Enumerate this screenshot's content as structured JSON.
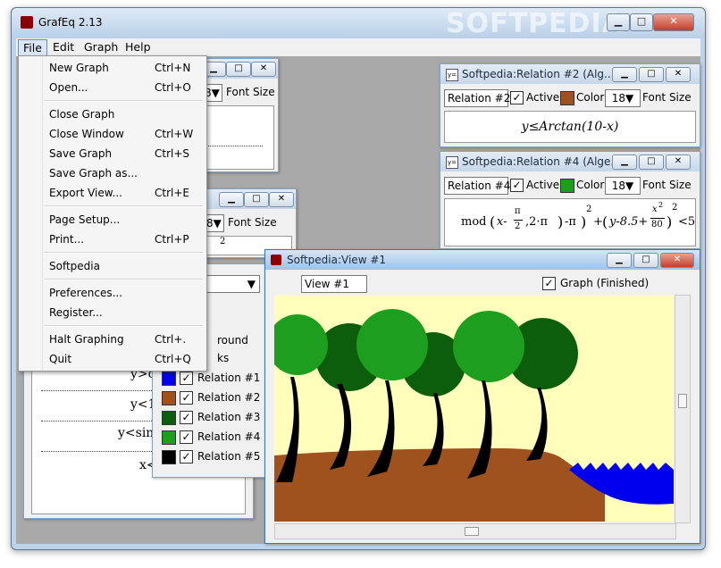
{
  "app": {
    "title": "GrafEq 2.13",
    "watermark": "SOFTPEDIA"
  },
  "menubar": [
    "File",
    "Edit",
    "Graph",
    "Help"
  ],
  "file_menu": {
    "groups": [
      [
        {
          "label": "New Graph",
          "shortcut": "Ctrl+N"
        },
        {
          "label": "Open...",
          "shortcut": "Ctrl+O"
        }
      ],
      [
        {
          "label": "Close Graph",
          "shortcut": ""
        },
        {
          "label": "Close Window",
          "shortcut": "Ctrl+W"
        },
        {
          "label": "Save Graph",
          "shortcut": "Ctrl+S"
        },
        {
          "label": "Save Graph as...",
          "shortcut": ""
        },
        {
          "label": "Export View...",
          "shortcut": "Ctrl+E"
        }
      ],
      [
        {
          "label": "Page Setup...",
          "shortcut": ""
        },
        {
          "label": "Print...",
          "shortcut": "Ctrl+P"
        }
      ],
      [
        {
          "label": "Softpedia",
          "shortcut": ""
        }
      ],
      [
        {
          "label": "Preferences...",
          "shortcut": ""
        },
        {
          "label": "Register...",
          "shortcut": ""
        }
      ],
      [
        {
          "label": "Halt Graphing",
          "shortcut": "Ctrl+."
        },
        {
          "label": "Quit",
          "shortcut": "Ctrl+Q"
        }
      ]
    ]
  },
  "rel2": {
    "title": "Softpedia:Relation #2 (Alg...",
    "name": "Relation #2",
    "active": "Active",
    "color_label": "Color",
    "color": "#a0521e",
    "font_size": "18",
    "font_size_label": "Font Size",
    "formula": "y≤Arctan(10-x)"
  },
  "rel4": {
    "title": "Softpedia:Relation #4 (Alge...",
    "name": "Relation #4",
    "active": "Active",
    "color_label": "Color",
    "color": "#1e9e1e",
    "font_size": "18",
    "font_size_label": "Font Size",
    "formula": {
      "f1": "mod",
      "f2": "x-",
      "f3": "π",
      "f4": "2",
      "f5": ",2·π",
      "f6": "-π",
      "f7": "2",
      "f8": "+",
      "f9": "y-8.5+",
      "f10": "x",
      "f11": "2",
      "f12": "80",
      "f13": "2",
      "f14": "<5"
    }
  },
  "rel_hidden_a": {
    "font_size": "8",
    "font_size_label": "Font Size"
  },
  "rel_hidden_b": {
    "font_size": "8",
    "font_size_label": "Font Size",
    "sup": "2"
  },
  "view": {
    "title": "Softpedia:View #1",
    "name": "View #1",
    "graph_status": "Graph (Finished)"
  },
  "bottom_ineq": {
    "r1": "y>c",
    "r2": "y<1",
    "r3": "y<sin",
    "r4": "x<9"
  },
  "relations_list": {
    "items": [
      {
        "label": "Background",
        "partial": "round"
      },
      {
        "label": "Ticks",
        "partial": "ks"
      },
      {
        "label": "Relation #1",
        "color": "#0000ee"
      },
      {
        "label": "Relation #2",
        "color": "#a0521e"
      },
      {
        "label": "Relation #3",
        "color": "#0c5e0c"
      },
      {
        "label": "Relation #4",
        "color": "#1e9e1e"
      },
      {
        "label": "Relation #5",
        "color": "#000000"
      }
    ]
  }
}
